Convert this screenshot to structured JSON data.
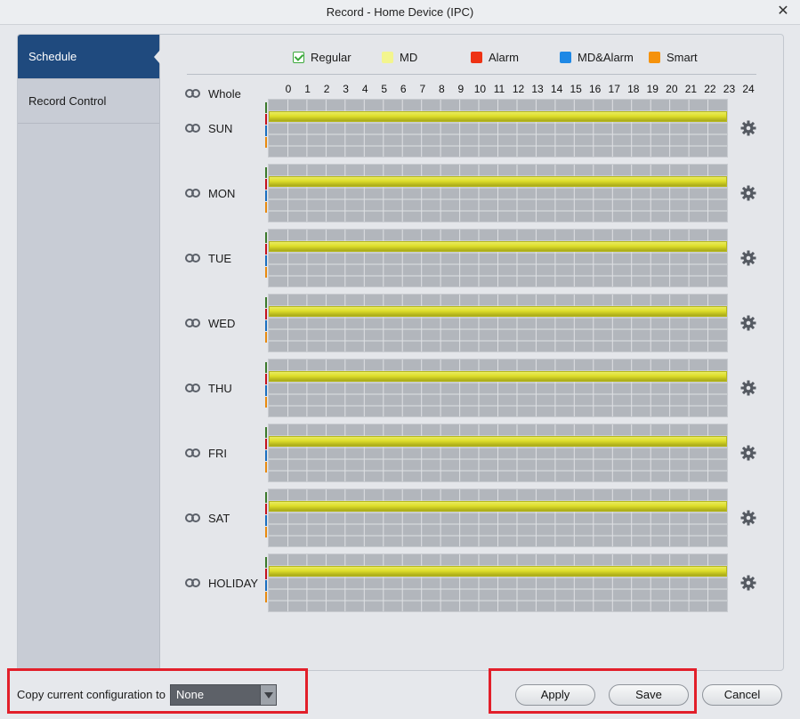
{
  "window": {
    "title": "Record - Home Device (IPC)",
    "close_glyph": "✕"
  },
  "sidebar": {
    "items": [
      {
        "label": "Schedule",
        "active": true
      },
      {
        "label": "Record Control",
        "active": false
      }
    ]
  },
  "legend": [
    {
      "label": "Regular",
      "color": "#3aa83a",
      "icon": "checkbox-checked-icon"
    },
    {
      "label": "MD",
      "color": "#f3f58e"
    },
    {
      "label": "Alarm",
      "color": "#ee3214"
    },
    {
      "label": "MD&Alarm",
      "color": "#1e88e5"
    },
    {
      "label": "Smart",
      "color": "#f5920c"
    }
  ],
  "whole_label": "Whole",
  "hours": [
    "0",
    "1",
    "2",
    "3",
    "4",
    "5",
    "6",
    "7",
    "8",
    "9",
    "10",
    "11",
    "12",
    "13",
    "14",
    "15",
    "16",
    "17",
    "18",
    "19",
    "20",
    "21",
    "22",
    "23",
    "24"
  ],
  "days": [
    {
      "label": "SUN",
      "md_range": [
        0,
        24
      ]
    },
    {
      "label": "MON",
      "md_range": [
        0,
        24
      ]
    },
    {
      "label": "TUE",
      "md_range": [
        0,
        24
      ]
    },
    {
      "label": "WED",
      "md_range": [
        0,
        24
      ]
    },
    {
      "label": "THU",
      "md_range": [
        0,
        24
      ]
    },
    {
      "label": "FRI",
      "md_range": [
        0,
        24
      ]
    },
    {
      "label": "SAT",
      "md_range": [
        0,
        24
      ]
    },
    {
      "label": "HOLIDAY",
      "md_range": [
        0,
        24
      ]
    }
  ],
  "copy_config": {
    "label": "Copy current configuration to",
    "selected": "None"
  },
  "buttons": {
    "apply": "Apply",
    "save": "Save",
    "cancel": "Cancel"
  }
}
